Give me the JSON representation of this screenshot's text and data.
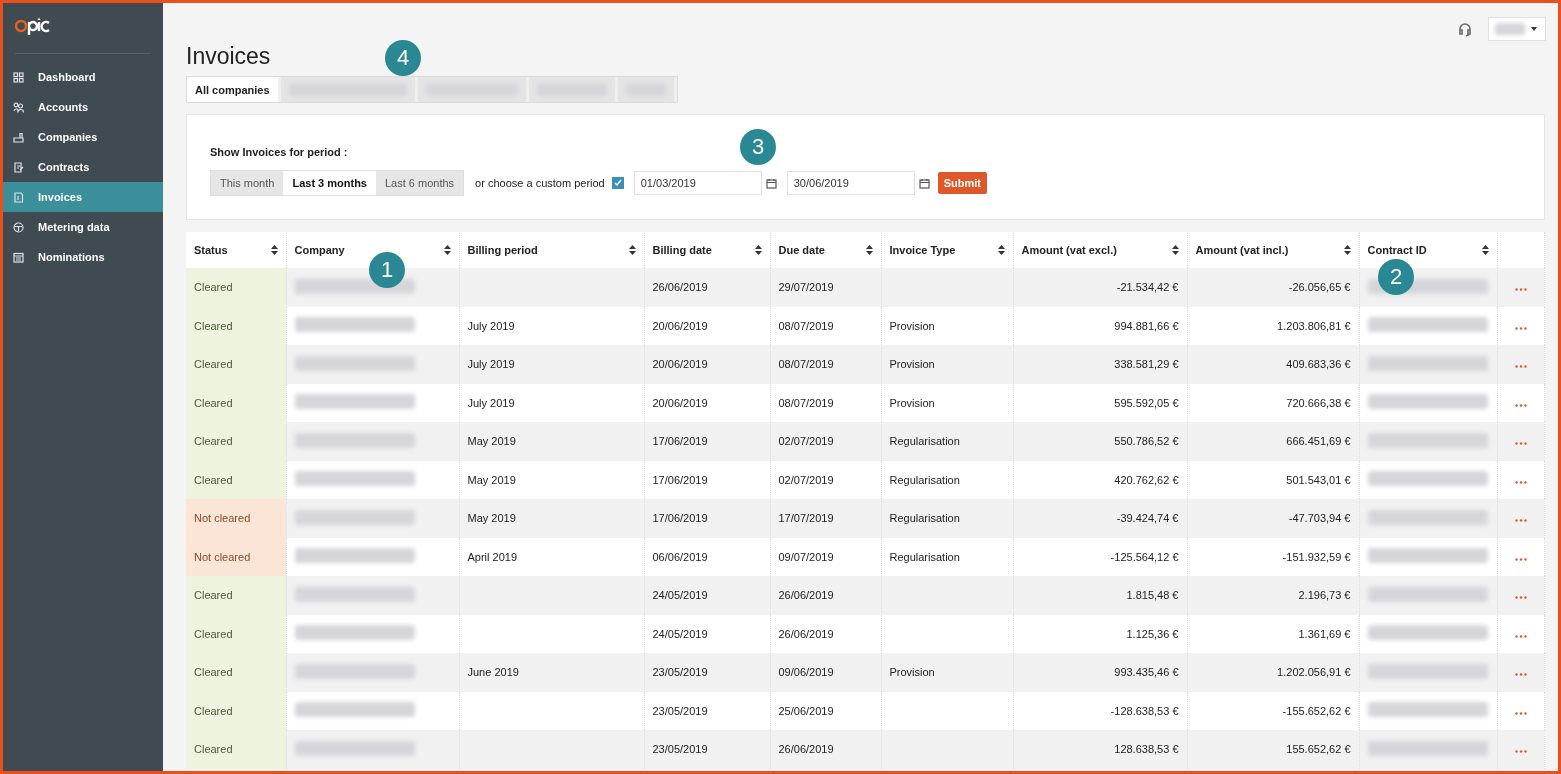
{
  "sidebar": {
    "items": [
      {
        "label": "Dashboard",
        "selected": false
      },
      {
        "label": "Accounts",
        "selected": false
      },
      {
        "label": "Companies",
        "selected": false
      },
      {
        "label": "Contracts",
        "selected": false
      },
      {
        "label": "Invoices",
        "selected": true
      },
      {
        "label": "Metering data",
        "selected": false
      },
      {
        "label": "Nominations",
        "selected": false
      }
    ]
  },
  "title": "Invoices",
  "company_tabs": [
    {
      "kind": "label",
      "label": "All companies",
      "selected": true
    },
    {
      "kind": "redacted",
      "selected": false
    },
    {
      "kind": "redacted",
      "selected": false
    },
    {
      "kind": "redacted",
      "selected": false
    },
    {
      "kind": "redacted",
      "selected": false
    }
  ],
  "period": {
    "label": "Show Invoices for period :",
    "options": [
      {
        "label": "This month",
        "selected": false
      },
      {
        "label": "Last 3 months",
        "selected": true
      },
      {
        "label": "Last 6 months",
        "selected": false
      }
    ],
    "custom_label": "or choose a custom period",
    "custom_checked": true,
    "from": "01/03/2019",
    "to": "30/06/2019",
    "submit": "Submit"
  },
  "table": {
    "columns": [
      "Status",
      "Company",
      "Billing period",
      "Billing date",
      "Due date",
      "Invoice Type",
      "Amount (vat excl.)",
      "Amount (vat incl.)",
      "Contract ID"
    ],
    "rows": [
      {
        "status": "Cleared",
        "cleared": true,
        "billing_period": "",
        "billing_date": "26/06/2019",
        "due_date": "29/07/2019",
        "invoice_type": "",
        "amount_excl": "-21.534,42 €",
        "amount_incl": "-26.056,65 €"
      },
      {
        "status": "Cleared",
        "cleared": true,
        "billing_period": "July 2019",
        "billing_date": "20/06/2019",
        "due_date": "08/07/2019",
        "invoice_type": "Provision",
        "amount_excl": "994.881,66 €",
        "amount_incl": "1.203.806,81 €"
      },
      {
        "status": "Cleared",
        "cleared": true,
        "billing_period": "July 2019",
        "billing_date": "20/06/2019",
        "due_date": "08/07/2019",
        "invoice_type": "Provision",
        "amount_excl": "338.581,29 €",
        "amount_incl": "409.683,36 €"
      },
      {
        "status": "Cleared",
        "cleared": true,
        "billing_period": "July 2019",
        "billing_date": "20/06/2019",
        "due_date": "08/07/2019",
        "invoice_type": "Provision",
        "amount_excl": "595.592,05 €",
        "amount_incl": "720.666,38 €"
      },
      {
        "status": "Cleared",
        "cleared": true,
        "billing_period": "May 2019",
        "billing_date": "17/06/2019",
        "due_date": "02/07/2019",
        "invoice_type": "Regularisation",
        "amount_excl": "550.786,52 €",
        "amount_incl": "666.451,69 €"
      },
      {
        "status": "Cleared",
        "cleared": true,
        "billing_period": "May 2019",
        "billing_date": "17/06/2019",
        "due_date": "02/07/2019",
        "invoice_type": "Regularisation",
        "amount_excl": "420.762,62 €",
        "amount_incl": "501.543,01 €"
      },
      {
        "status": "Not cleared",
        "cleared": false,
        "billing_period": "May 2019",
        "billing_date": "17/06/2019",
        "due_date": "17/07/2019",
        "invoice_type": "Regularisation",
        "amount_excl": "-39.424,74 €",
        "amount_incl": "-47.703,94 €"
      },
      {
        "status": "Not cleared",
        "cleared": false,
        "billing_period": "April 2019",
        "billing_date": "06/06/2019",
        "due_date": "09/07/2019",
        "invoice_type": "Regularisation",
        "amount_excl": "-125.564,12 €",
        "amount_incl": "-151.932,59 €"
      },
      {
        "status": "Cleared",
        "cleared": true,
        "billing_period": "",
        "billing_date": "24/05/2019",
        "due_date": "26/06/2019",
        "invoice_type": "",
        "amount_excl": "1.815,48 €",
        "amount_incl": "2.196,73 €"
      },
      {
        "status": "Cleared",
        "cleared": true,
        "billing_period": "",
        "billing_date": "24/05/2019",
        "due_date": "26/06/2019",
        "invoice_type": "",
        "amount_excl": "1.125,36 €",
        "amount_incl": "1.361,69 €"
      },
      {
        "status": "Cleared",
        "cleared": true,
        "billing_period": "June 2019",
        "billing_date": "23/05/2019",
        "due_date": "09/06/2019",
        "invoice_type": "Provision",
        "amount_excl": "993.435,46 €",
        "amount_incl": "1.202.056,91 €"
      },
      {
        "status": "Cleared",
        "cleared": true,
        "billing_period": "",
        "billing_date": "23/05/2019",
        "due_date": "25/06/2019",
        "invoice_type": "",
        "amount_excl": "-128.638,53 €",
        "amount_incl": "-155.652,62 €"
      },
      {
        "status": "Cleared",
        "cleared": true,
        "billing_period": "",
        "billing_date": "23/05/2019",
        "due_date": "26/06/2019",
        "invoice_type": "",
        "amount_excl": "128.638,53 €",
        "amount_incl": "155.652,62 €"
      }
    ]
  },
  "callouts": [
    "1",
    "2",
    "3",
    "4"
  ]
}
